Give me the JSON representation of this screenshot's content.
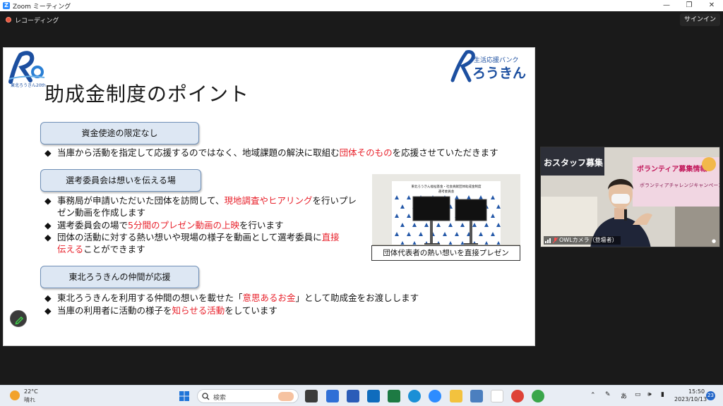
{
  "window": {
    "title": "Zoom ミーティング",
    "minimize": "—",
    "restore": "❐",
    "close": "✕"
  },
  "meeting": {
    "recording_label": "レコーディング",
    "signin_label": "サインイン"
  },
  "slide": {
    "title": "助成金制度のポイント",
    "logo_left_text": "東北ろうきん20th",
    "logo_right_small": "生活応援バンク",
    "logo_right_big": "ろうきん",
    "sections": [
      {
        "heading": "資金使途の限定なし"
      },
      {
        "heading": "選考委員会は想いを伝える場"
      },
      {
        "heading": "東北ろうきんの仲間が応援"
      }
    ],
    "bullet_marker": "◆",
    "b1": {
      "a": "当庫から活動を指定して応援するのではなく、地域課題の解決に取組む",
      "red": "団体そのもの",
      "b": "を応援させていただきます"
    },
    "b2": {
      "a": "事務局が申請いただいた団体を訪問して、",
      "red": "現地調査やヒアリング",
      "b": "を行いプレ",
      "cont": "ゼン動画を作成します"
    },
    "b3": {
      "a": "選考委員会の場で",
      "red": "5分間のプレゼン動画の上映",
      "b": "を行います"
    },
    "b4": {
      "a": "団体の活動に対する熱い想いや現場の様子を動画として選考委員に",
      "red": "直接",
      "cont_red": "伝える",
      "cont_b": "ことができます"
    },
    "b5": {
      "a": "東北ろうきんを利用する仲間の想いを載せた「",
      "red": "意思あるお金",
      "b": "」として助成金をお渡しします"
    },
    "b6": {
      "a": "当庫の利用者に活動の様子を",
      "red": "知らせる活動",
      "b": "をしています"
    },
    "photo": {
      "banner_line1": "東北ろうきん福祉基金・社会貢献団体助成金制度",
      "banner_line2": "選考委員会"
    },
    "photo_caption": "団体代表者の熱い想いを直接プレゼン",
    "colors": {
      "accent_red": "#e8212b",
      "pill_fill": "#dde7f3",
      "logo_blue": "#1c4fa0"
    }
  },
  "video": {
    "participant_label": "OWLカメラ（登壇者）",
    "bg_sign1": "おスタッフ募集",
    "bg_sign2": "ボランティア募集情報",
    "bg_sign3": "ボランティアチャレンジキャンペーン"
  },
  "taskbar": {
    "weather_temp": "22°C",
    "weather_desc": "晴れ",
    "search_placeholder": "検索",
    "ime_label": "あ",
    "time": "15:50",
    "date": "2023/10/13",
    "notification_count": "23"
  }
}
